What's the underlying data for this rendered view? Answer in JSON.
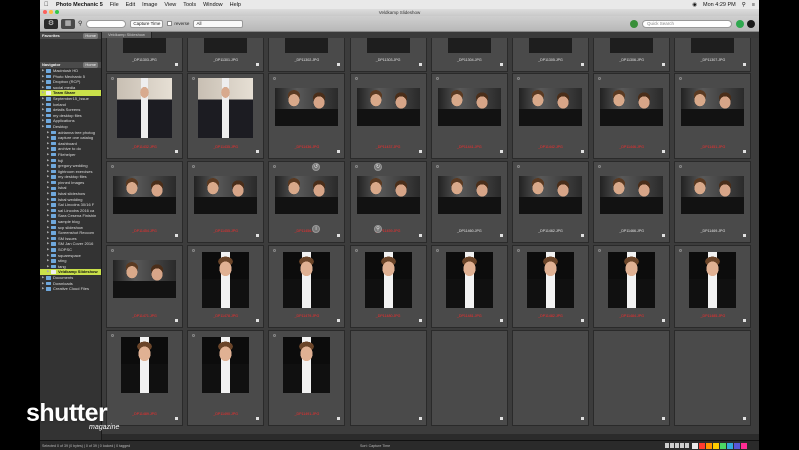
{
  "menubar": {
    "app_name": "Photo Mechanic 5",
    "items": [
      "File",
      "Edit",
      "Image",
      "View",
      "Tools",
      "Window",
      "Help"
    ],
    "clock": "Mon 4:29 PM"
  },
  "window": {
    "title": "Veldkamp Slideshow"
  },
  "toolbar": {
    "sort_value": "Capture Time",
    "reverse_label": "reverse",
    "filter_value": "All",
    "quick_search_placeholder": "Quick Search"
  },
  "tabs": [
    "Veldkamp Slideshow"
  ],
  "sidebar": {
    "favorites_label": "Favorites",
    "navigator_label": "Navigator",
    "header_button": "Home",
    "tree": [
      {
        "label": "Macintosh HD",
        "depth": 0
      },
      {
        "label": "Photo Mechanic 5",
        "depth": 0
      },
      {
        "label": "Dropbox (RCP)",
        "depth": 0
      },
      {
        "label": "social media",
        "depth": 0
      },
      {
        "label": "Team Share",
        "depth": 0,
        "selected": true
      },
      {
        "label": "September15_Issue",
        "depth": 0
      },
      {
        "label": "Iceland",
        "depth": 0
      },
      {
        "label": "details Screens",
        "depth": 0
      },
      {
        "label": "my desktop files",
        "depth": 0
      },
      {
        "label": "Applications",
        "depth": 0
      },
      {
        "label": "Desktop",
        "depth": 0
      },
      {
        "label": "adrianna tree photog",
        "depth": 1
      },
      {
        "label": "capture one catalog",
        "depth": 1
      },
      {
        "label": "dashboard",
        "depth": 1
      },
      {
        "label": "archive to do",
        "depth": 1
      },
      {
        "label": "Filehelper",
        "depth": 1
      },
      {
        "label": "fuji",
        "depth": 1
      },
      {
        "label": "gregory wedding",
        "depth": 1
      },
      {
        "label": "lightroom exercises",
        "depth": 1
      },
      {
        "label": "my desktop files",
        "depth": 1
      },
      {
        "label": "pinned Images",
        "depth": 1
      },
      {
        "label": "Isbal",
        "depth": 1
      },
      {
        "label": "Isbal slideshow",
        "depth": 1
      },
      {
        "label": "Isbal wedding",
        "depth": 1
      },
      {
        "label": "Sal Lincolns 30/16 F",
        "depth": 1
      },
      {
        "label": "sal Lincolns 2016 ca",
        "depth": 1
      },
      {
        "label": "Sara Cesena Finishin",
        "depth": 1
      },
      {
        "label": "sample blog",
        "depth": 1
      },
      {
        "label": "scp slideshow",
        "depth": 1
      },
      {
        "label": "Screenshot Reccom",
        "depth": 1
      },
      {
        "label": "SM Issues",
        "depth": 1
      },
      {
        "label": "SM Jan Cover 2016",
        "depth": 1
      },
      {
        "label": "SOPSC",
        "depth": 1
      },
      {
        "label": "squarespace",
        "depth": 1
      },
      {
        "label": "sting",
        "depth": 1
      },
      {
        "label": "tang",
        "depth": 1
      },
      {
        "label": "Veldkamp Slideshow",
        "depth": 1,
        "selected": true
      },
      {
        "label": "Documents",
        "depth": 0
      },
      {
        "label": "Downloads",
        "depth": 0
      },
      {
        "label": "Creative Cloud Files",
        "depth": 0
      }
    ]
  },
  "grid": {
    "rows": [
      {
        "cells": [
          {
            "label": "_DP11303.JPG",
            "kind": "dark",
            "label_red": false
          },
          {
            "label": "_DP11301.JPG",
            "kind": "dark",
            "label_red": false
          },
          {
            "label": "_DP11302.JPG",
            "kind": "dark",
            "label_red": false
          },
          {
            "label": "_DP11303.JPG",
            "kind": "dark",
            "label_red": false
          },
          {
            "label": "_DP11304.JPG",
            "kind": "dark",
            "label_red": false
          },
          {
            "label": "_DP11305.JPG",
            "kind": "dark",
            "label_red": false
          },
          {
            "label": "_DP11306.JPG",
            "kind": "dark",
            "label_red": false
          },
          {
            "label": "_DP11307.JPG",
            "kind": "dark",
            "label_red": false
          }
        ]
      },
      {
        "cells": [
          {
            "label": "_DP11432.JPG",
            "kind": "man",
            "label_red": true
          },
          {
            "label": "_DP11435.JPG",
            "kind": "man",
            "label_red": true
          },
          {
            "label": "_DP11436.JPG",
            "kind": "boy-wide",
            "label_red": true
          },
          {
            "label": "_DP11437.JPG",
            "kind": "boy-wide",
            "label_red": true
          },
          {
            "label": "_DP11441.JPG",
            "kind": "boy-wide",
            "label_red": true
          },
          {
            "label": "_DP11442.JPG",
            "kind": "boy-wide",
            "label_red": true
          },
          {
            "label": "_DP11446.JPG",
            "kind": "boy-wide",
            "label_red": true
          },
          {
            "label": "_DP11451.JPG",
            "kind": "boy-wide",
            "label_red": true
          }
        ]
      },
      {
        "cells": [
          {
            "label": "_DP11454.JPG",
            "kind": "boy-wide",
            "label_red": true
          },
          {
            "label": "_DP11455.JPG",
            "kind": "boy-wide",
            "label_red": true
          },
          {
            "label": "_DP11456.JPG",
            "kind": "boy-wide",
            "label_red": true
          },
          {
            "label": "_DP11459.JPG",
            "kind": "boy-wide",
            "label_red": true
          },
          {
            "label": "_DP11460.JPG",
            "kind": "boy-wide",
            "label_red": false
          },
          {
            "label": "_DP11462.JPG",
            "kind": "boy-wide",
            "label_red": false
          },
          {
            "label": "_DP11466.JPG",
            "kind": "boy-wide",
            "label_red": false
          },
          {
            "label": "_DP11469.JPG",
            "kind": "boy-wide",
            "label_red": false
          }
        ]
      },
      {
        "cells": [
          {
            "label": "_DP11471.JPG",
            "kind": "boy-wide",
            "label_red": true
          },
          {
            "label": "_DP11478.JPG",
            "kind": "boy-tall",
            "label_red": true
          },
          {
            "label": "_DP11479.JPG",
            "kind": "boy-tall",
            "label_red": true
          },
          {
            "label": "_DP11480.JPG",
            "kind": "boy-tall",
            "label_red": true
          },
          {
            "label": "_DP11481.JPG",
            "kind": "boy-tall",
            "label_red": true
          },
          {
            "label": "_DP11482.JPG",
            "kind": "boy-tall",
            "label_red": true
          },
          {
            "label": "_DP11484.JPG",
            "kind": "boy-tall",
            "label_red": true
          },
          {
            "label": "_DP11485.JPG",
            "kind": "boy-tall",
            "label_red": true
          }
        ]
      },
      {
        "cells": [
          {
            "label": "_DP11489.JPG",
            "kind": "boy-tall",
            "label_red": true
          },
          {
            "label": "_DP11490.JPG",
            "kind": "boy-tall",
            "label_red": true
          },
          {
            "label": "_DP11491.JPG",
            "kind": "boy-tall",
            "label_red": true
          },
          {
            "label": "",
            "kind": "empty",
            "label_red": false
          },
          {
            "label": "",
            "kind": "empty",
            "label_red": false
          },
          {
            "label": "",
            "kind": "empty",
            "label_red": false
          },
          {
            "label": "",
            "kind": "empty",
            "label_red": false
          },
          {
            "label": "",
            "kind": "empty",
            "label_red": false
          }
        ]
      }
    ]
  },
  "footer": {
    "status_left": "Selected 0 of 39 (0 bytes) | 0 of 39 | 0 locked | 0 tagged",
    "status_mid": "Sort: Capture Time",
    "color_classes": [
      "#e8e8e8",
      "#ff3b30",
      "#ff9500",
      "#ffcc00",
      "#4cd964",
      "#34aadc",
      "#5856d6",
      "#ff2d95"
    ]
  },
  "watermark": {
    "brand": "shutter",
    "sub": "magazine"
  },
  "colors": {
    "accent_selected": "#c9e04a",
    "label_red": "#ff2a2a",
    "folder_blue": "#6fa8dc"
  }
}
